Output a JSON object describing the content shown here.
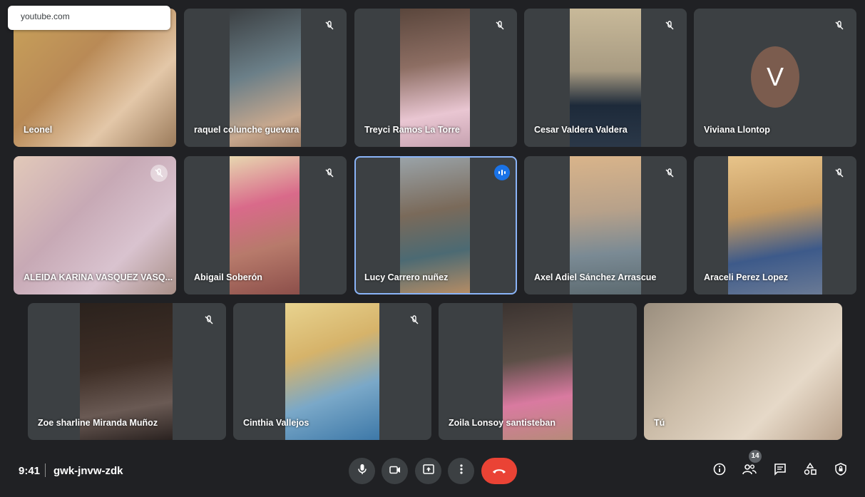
{
  "browser_toast": {
    "url": "youtube.com"
  },
  "participants": [
    {
      "name": "Leonel",
      "muted": false,
      "video_color": "#b98a56"
    },
    {
      "name": "raquel colunche guevara",
      "muted": true,
      "video_color": "#6b7f88"
    },
    {
      "name": "Treyci Ramos La Torre",
      "muted": true,
      "video_color": "#8d6e63"
    },
    {
      "name": "Cesar Valdera Valdera",
      "muted": true,
      "video_color": "#a89b82"
    },
    {
      "name": "Viviana Llontop",
      "muted": true,
      "avatar_letter": "V",
      "avatar_color": "#7b5c4e"
    },
    {
      "name": "ALEIDA KARINA VASQUEZ VASQ...",
      "muted": true,
      "video_color": "#c7a9b5"
    },
    {
      "name": "Abigail Soberón",
      "muted": true,
      "video_color": "#b77a6b"
    },
    {
      "name": "Lucy Carrero nuñez",
      "muted": false,
      "speaking": true,
      "video_color": "#7a6a5a"
    },
    {
      "name": "Axel Adiel Sánchez Arrascue",
      "muted": true,
      "video_color": "#b7a18a"
    },
    {
      "name": "Araceli Perez Lopez",
      "muted": true,
      "video_color": "#c49a62"
    },
    {
      "name": "Zoe sharline Miranda Muñoz",
      "muted": true,
      "video_color": "#3e2e26"
    },
    {
      "name": "Cinthia Vallejos",
      "muted": true,
      "video_color": "#d6b36a"
    },
    {
      "name": "Zoila Lonsoy santisteban",
      "muted": false,
      "video_color": "#5c4f47"
    },
    {
      "name": "Tú",
      "muted": false,
      "video_color": "#cbbca8"
    }
  ],
  "bottom_bar": {
    "time": "9:41",
    "meeting_code": "gwk-jnvw-zdk",
    "participant_count": "14",
    "controls": [
      "mic-icon",
      "camera-icon",
      "present-icon",
      "more-options-icon",
      "end-call-icon"
    ],
    "right_controls": [
      "info-icon",
      "people-icon",
      "chat-icon",
      "activities-icon",
      "host-controls-icon"
    ]
  },
  "colors": {
    "background": "#202124",
    "tile": "#3c4043",
    "hangup": "#ea4335",
    "speaking": "#1a73e8"
  }
}
